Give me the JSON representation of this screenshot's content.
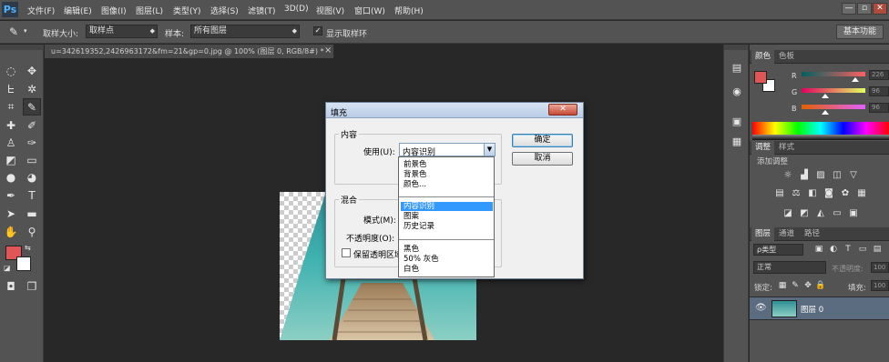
{
  "app": {
    "logo": "Ps"
  },
  "menu": [
    "文件(F)",
    "编辑(E)",
    "图像(I)",
    "图层(L)",
    "类型(Y)",
    "选择(S)",
    "滤镜(T)",
    "3D(D)",
    "视图(V)",
    "窗口(W)",
    "帮助(H)"
  ],
  "window_controls": {
    "minimize": "—",
    "restore": "▫",
    "close": "✕"
  },
  "options": {
    "sample_size_label": "取样大小:",
    "sample_size_value": "取样点",
    "sample_label": "样本:",
    "sample_value": "所有图层",
    "show_ring_label": "显示取样环",
    "show_ring_checked": true,
    "workspace_label": "基本功能"
  },
  "document": {
    "tab_title": "u=342619352,2426963172&fm=21&gp=0.jpg @ 100% (图层 0, RGB/8#) *",
    "close": "×"
  },
  "colors": {
    "foreground": "#e05656",
    "background": "#ffffff",
    "accent": "#3399ff"
  },
  "dialog": {
    "title": "填充",
    "close": "✕",
    "content_group": "内容",
    "use_label": "使用(U):",
    "use_value": "内容识别",
    "blend_group": "混合",
    "mode_label": "模式(M):",
    "opacity_label": "不透明度(O):",
    "preserve_label": "保留透明区域",
    "ok": "确定",
    "cancel": "取消",
    "dropdown": {
      "group1": [
        "前景色",
        "背景色",
        "颜色..."
      ],
      "group2": [
        "内容识别",
        "图案",
        "历史记录"
      ],
      "group3": [
        "黑色",
        "50% 灰色",
        "白色"
      ],
      "selected": "内容识别"
    }
  },
  "color_panel": {
    "tabs": [
      "颜色",
      "色板"
    ],
    "channels": [
      {
        "name": "R",
        "value": "226"
      },
      {
        "name": "G",
        "value": "96"
      },
      {
        "name": "B",
        "value": "96"
      }
    ]
  },
  "adjustments_panel": {
    "tabs": [
      "调整",
      "样式"
    ],
    "add_label": "添加调整"
  },
  "layers_panel": {
    "tabs": [
      "图层",
      "通道",
      "路径"
    ],
    "filter_label": "ρ类型",
    "blend_mode": "正常",
    "opacity_label": "不透明度:",
    "opacity_value": "100",
    "lock_label": "锁定:",
    "fill_label": "填充:",
    "fill_value": "100",
    "layers": [
      {
        "name": "图层 0",
        "visible": true
      }
    ]
  }
}
